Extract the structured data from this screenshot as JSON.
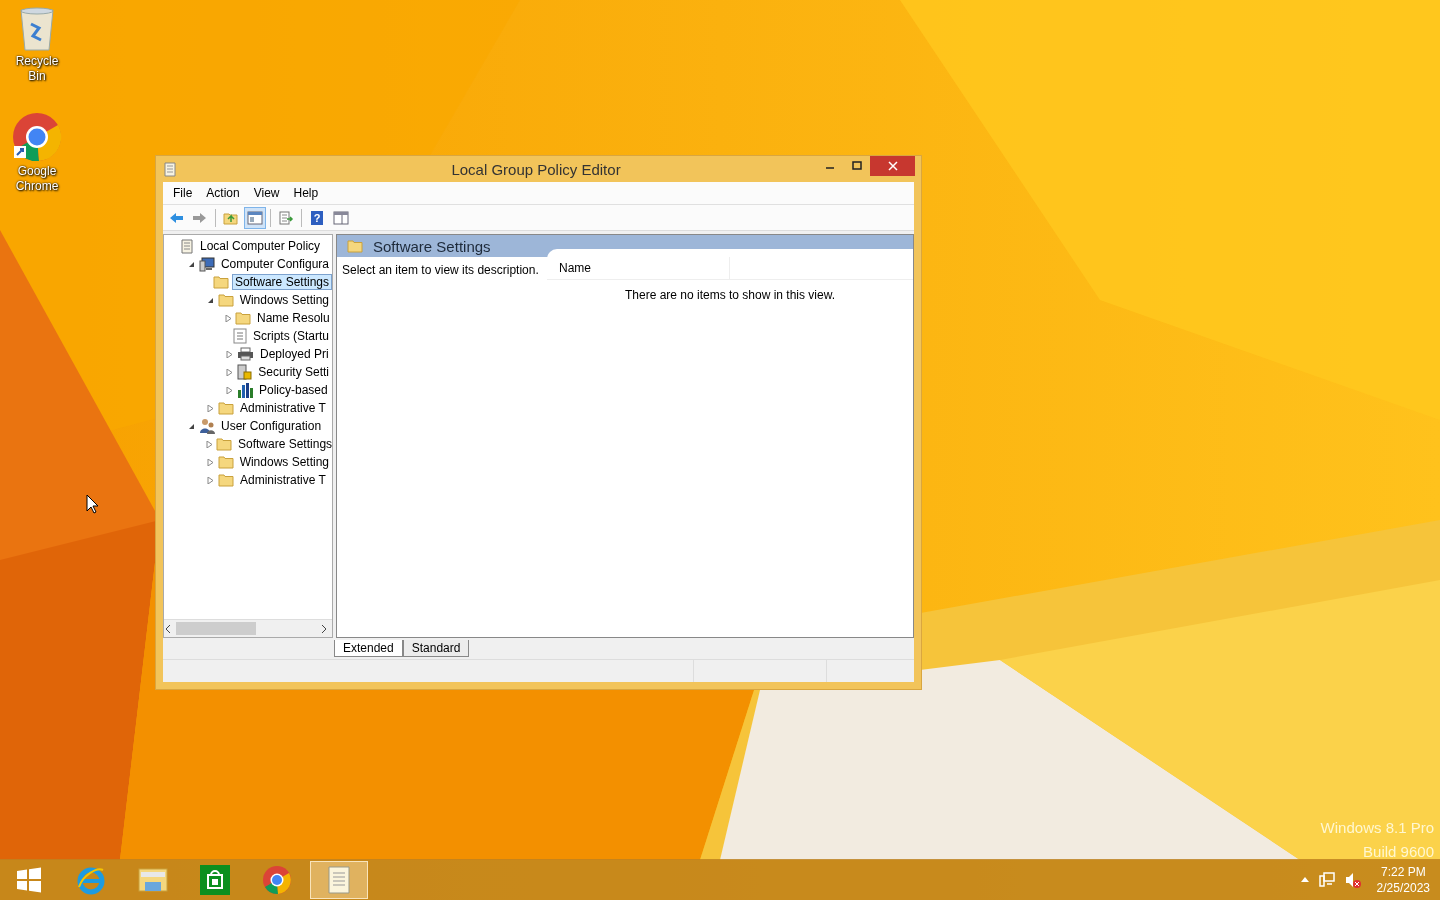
{
  "desktop": {
    "icons": [
      {
        "kind": "recycle-bin",
        "label": "Recycle Bin"
      },
      {
        "kind": "chrome",
        "label": "Google Chrome"
      }
    ],
    "edition": [
      "Windows 8.1 Pro",
      "Build 9600"
    ]
  },
  "window": {
    "title": "Local Group Policy Editor",
    "menu": [
      "File",
      "Action",
      "View",
      "Help"
    ],
    "toolbar": [
      {
        "kind": "back",
        "pressed": false
      },
      {
        "kind": "forward",
        "pressed": false
      },
      {
        "kind": "up",
        "pressed": false
      },
      {
        "kind": "tree",
        "pressed": true
      },
      {
        "kind": "export",
        "pressed": false
      },
      {
        "kind": "help",
        "pressed": false,
        "glyph": "?"
      },
      {
        "kind": "view",
        "pressed": false
      }
    ],
    "tree": [
      {
        "label": "Local Computer Policy",
        "kind": "policy",
        "selected": false,
        "children": [
          {
            "label": "Computer Configura",
            "kind": "computer",
            "selected": false,
            "expanded": true,
            "children": [
              {
                "label": "Software Settings",
                "kind": "folder",
                "selected": true
              },
              {
                "label": "Windows Setting",
                "kind": "folder",
                "selected": false,
                "expanded": true,
                "children": [
                  {
                    "label": "Name Resolu",
                    "kind": "folder",
                    "selected": false,
                    "expanded": false
                  },
                  {
                    "label": "Scripts (Startu",
                    "kind": "script",
                    "selected": false
                  },
                  {
                    "label": "Deployed Pri",
                    "kind": "printer",
                    "selected": false,
                    "expanded": false
                  },
                  {
                    "label": "Security Setti",
                    "kind": "security",
                    "selected": false,
                    "expanded": false
                  },
                  {
                    "label": "Policy-based",
                    "kind": "chart",
                    "selected": false,
                    "expanded": false
                  }
                ]
              },
              {
                "label": "Administrative T",
                "kind": "folder",
                "selected": false,
                "expanded": false
              }
            ]
          },
          {
            "label": "User Configuration",
            "kind": "user",
            "selected": false,
            "expanded": true,
            "children": [
              {
                "label": "Software Settings",
                "kind": "folder",
                "selected": false,
                "expanded": false
              },
              {
                "label": "Windows Setting",
                "kind": "folder",
                "selected": false,
                "expanded": false
              },
              {
                "label": "Administrative T",
                "kind": "folder",
                "selected": false,
                "expanded": false
              }
            ]
          }
        ]
      }
    ],
    "details": {
      "title": "Software Settings",
      "description": "Select an item to view its description.",
      "columns": [
        "Name"
      ],
      "empty_message": "There are no items to show in this view."
    },
    "view_tabs": [
      {
        "label": "Extended",
        "selected": true
      },
      {
        "label": "Standard",
        "selected": false
      }
    ]
  },
  "taskbar": {
    "items": [
      {
        "kind": "start",
        "selected": false
      },
      {
        "kind": "ie",
        "selected": false
      },
      {
        "kind": "explorer",
        "selected": false
      },
      {
        "kind": "store",
        "selected": false
      },
      {
        "kind": "chrome",
        "selected": false
      },
      {
        "kind": "gpedit",
        "selected": true
      }
    ],
    "time": "7:22 PM",
    "date": "2/25/2023"
  }
}
